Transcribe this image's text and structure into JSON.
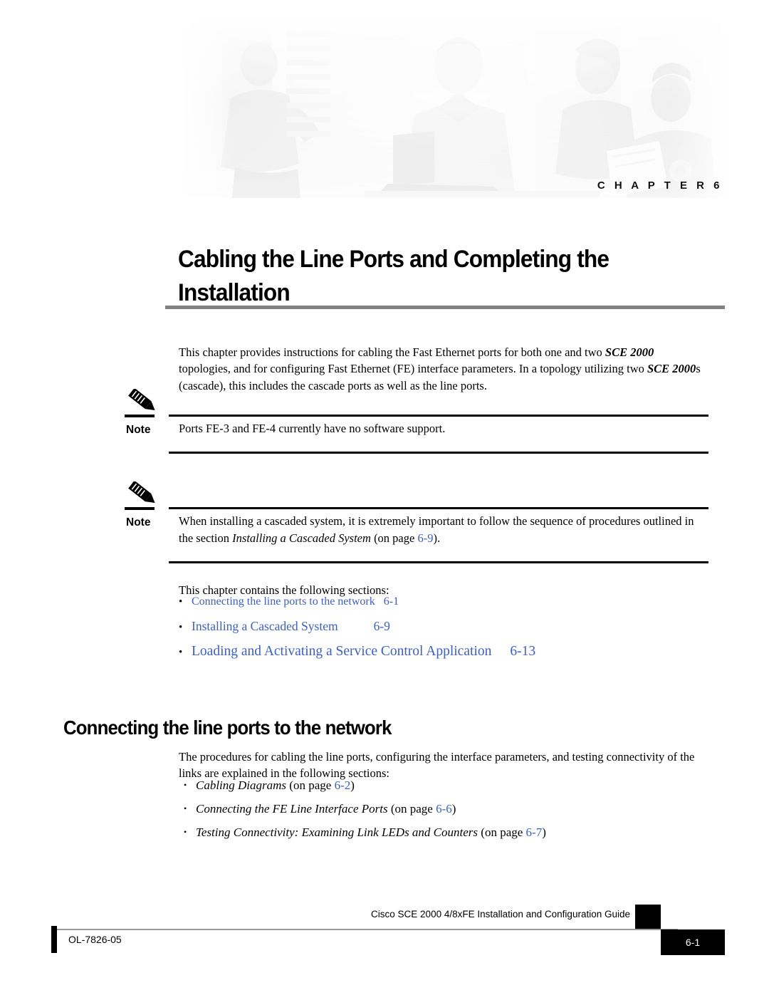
{
  "banner": {
    "chapter_label": "C H A P T E R   6",
    "image_description": "grayscale-people-technology-collage"
  },
  "chapter": {
    "title_line1": "Cabling the Line Ports and Completing the",
    "title_line2": "Installation"
  },
  "intro": {
    "t1": "This chapter provides instructions for cabling the Fast Ethernet ports for both one and two ",
    "em1": "SCE 2000",
    "t2": " topologies, and for configuring Fast Ethernet (FE) interface parameters. In a topology utilizing two ",
    "em2": "SCE 2000",
    "t3": "s (cascade), this includes the cascade ports as well as the line ports."
  },
  "notes": [
    {
      "label": "Note",
      "text": "Ports FE-3 and FE-4 currently have no software support."
    },
    {
      "label": "Note",
      "t1": "When installing a cascaded system, it is extremely important to follow the sequence of procedures outlined in the section ",
      "em1": "Installing a Cascaded System",
      "t2": " (on page ",
      "page": "6-9",
      "t3": ")."
    }
  ],
  "contains_intro": "This chapter contains the following sections:",
  "toc": {
    "bullet": "•",
    "items": [
      {
        "label": "Connecting the line ports to the network",
        "page": "6-1"
      },
      {
        "label": "Installing a Cascaded System",
        "page": "6-9"
      },
      {
        "label": "Loading and Activating a Service Control Application",
        "page": "6-13"
      }
    ]
  },
  "section": {
    "heading": "Connecting the line ports to the network",
    "paragraph": "The procedures for cabling the line ports, configuring the interface parameters, and testing connectivity of the links are explained in the following sections:"
  },
  "subsections": {
    "bullet": "•",
    "on_page_prefix": " (on page ",
    "on_page_suffix": ")",
    "items": [
      {
        "title": "Cabling Diagrams",
        "page": "6-2"
      },
      {
        "title": "Connecting the FE Line Interface Ports",
        "page": "6-6"
      },
      {
        "title": "Testing Connectivity: Examining Link LEDs and Counters",
        "page": "6-7"
      }
    ]
  },
  "footer": {
    "document_title": "Cisco SCE 2000 4/8xFE Installation and Configuration Guide",
    "doc_number": "OL-7826-05",
    "page_number": "6-1"
  },
  "colors": {
    "link_blue": "#3b5ed0",
    "rule_gray": "#808080",
    "footer_rule_gray": "#999999"
  }
}
